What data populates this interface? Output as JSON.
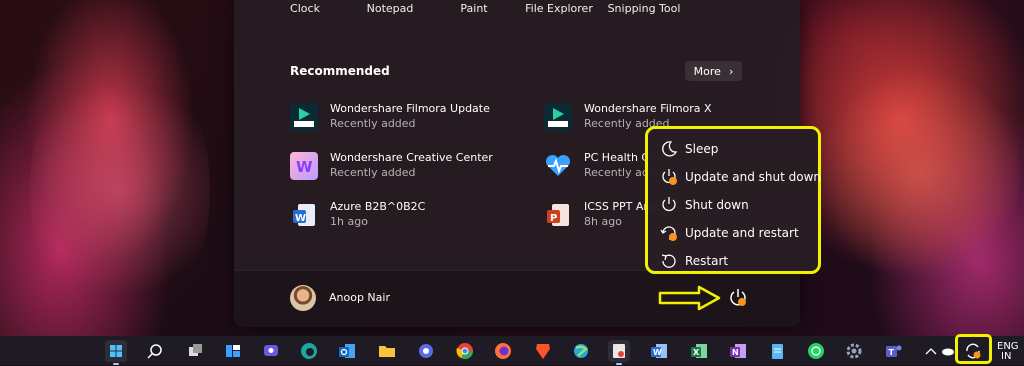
{
  "pinned": [
    "Clock",
    "Notepad",
    "Paint",
    "File Explorer",
    "Snipping Tool"
  ],
  "recommended": {
    "title": "Recommended",
    "more_label": "More",
    "items": [
      {
        "name": "Wondershare Filmora Update",
        "sub": "Recently added",
        "icon": "filmora-icon"
      },
      {
        "name": "Wondershare Filmora X",
        "sub": "Recently added",
        "icon": "filmora-icon"
      },
      {
        "name": "Wondershare Creative Center",
        "sub": "Recently added",
        "icon": "creative-center-icon"
      },
      {
        "name": "PC Health Ch",
        "sub": "Recently add",
        "icon": "pc-health-icon"
      },
      {
        "name": "Azure B2B^0B2C",
        "sub": "1h ago",
        "icon": "word-doc-icon"
      },
      {
        "name": "ICSS PPT And",
        "sub": "8h ago",
        "icon": "powerpoint-icon"
      }
    ]
  },
  "user": {
    "name": "Anoop Nair"
  },
  "power_menu": {
    "items": [
      {
        "label": "Sleep",
        "icon": "moon-icon"
      },
      {
        "label": "Update and shut down",
        "icon": "update-power-icon"
      },
      {
        "label": "Shut down",
        "icon": "power-icon"
      },
      {
        "label": "Update and restart",
        "icon": "update-restart-icon"
      },
      {
        "label": "Restart",
        "icon": "restart-icon"
      }
    ]
  },
  "taskbar": {
    "language": "ENG",
    "language_sub": "IN"
  },
  "colors": {
    "highlight": "#f3f000",
    "update_dot": "#f7931e",
    "accent": "#9ad0ff"
  }
}
